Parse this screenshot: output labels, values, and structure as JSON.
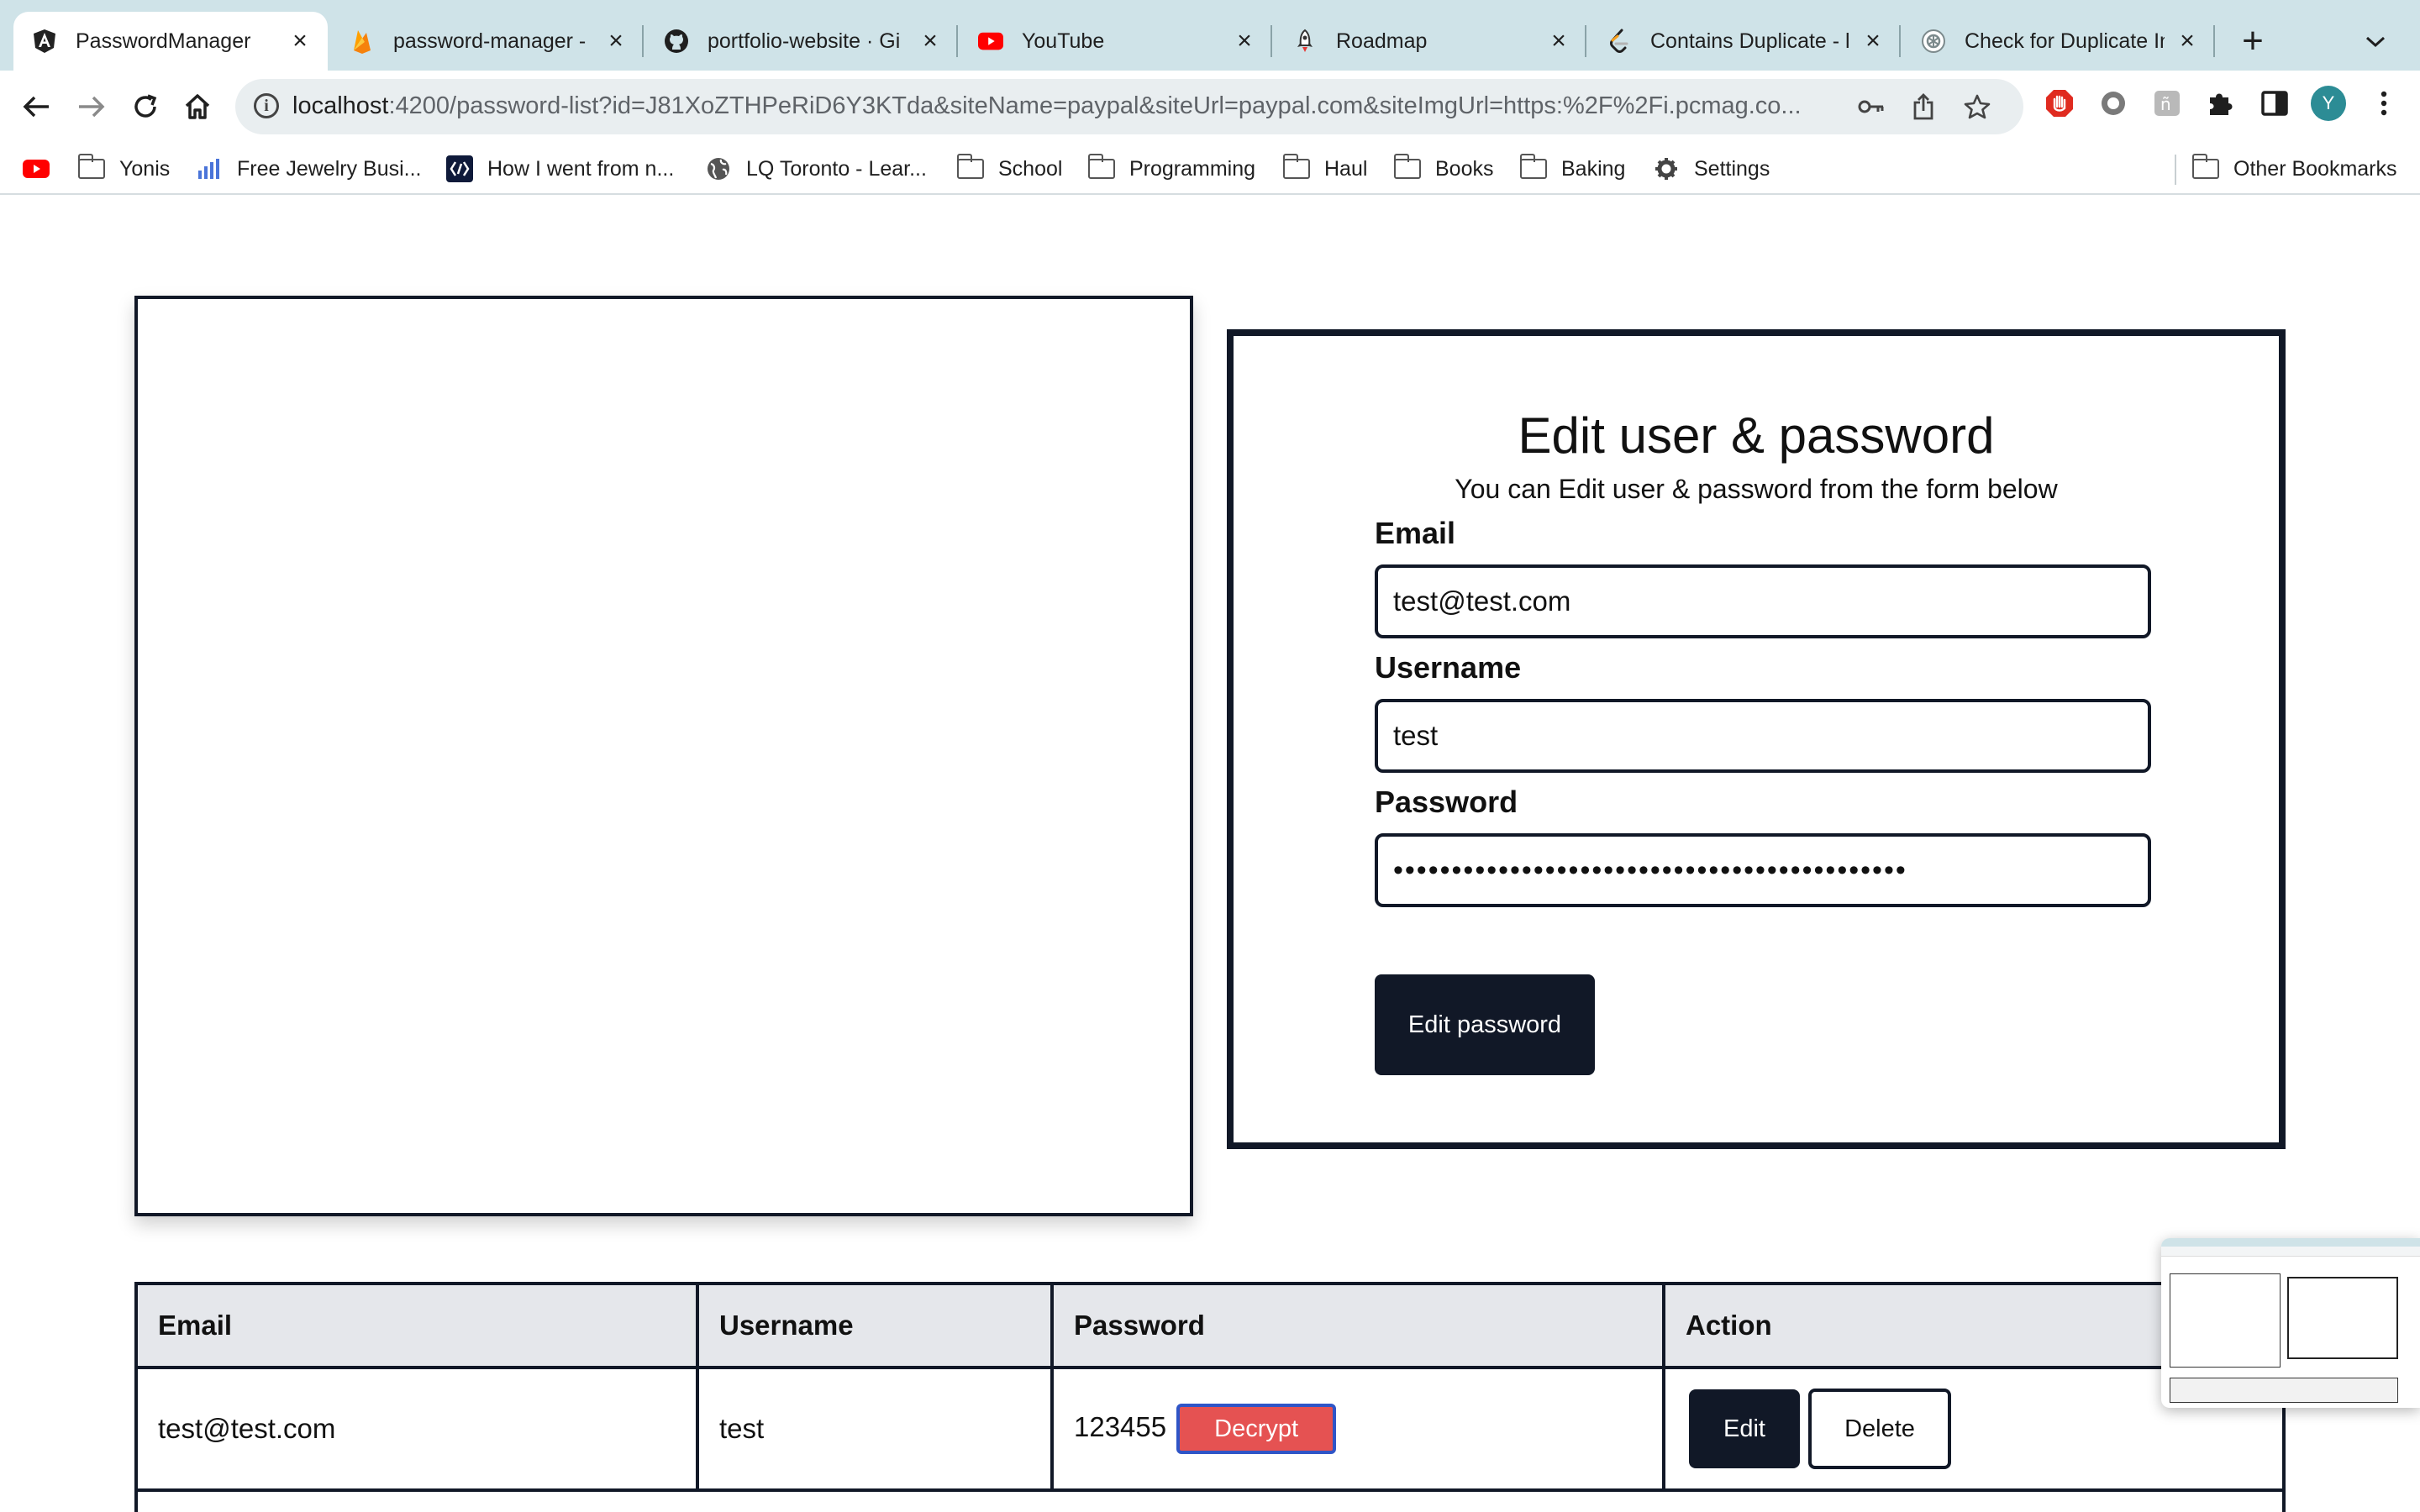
{
  "browser": {
    "tabs": [
      {
        "title": "PasswordManager",
        "icon": "angular-icon",
        "active": true
      },
      {
        "title": "password-manager - ",
        "icon": "firebase-icon",
        "active": false
      },
      {
        "title": "portfolio-website · Gi",
        "icon": "github-icon",
        "active": false
      },
      {
        "title": "YouTube",
        "icon": "youtube-icon",
        "active": false
      },
      {
        "title": "Roadmap",
        "icon": "rocket-icon",
        "active": false
      },
      {
        "title": "Contains Duplicate - l",
        "icon": "leetcode-icon",
        "active": false
      },
      {
        "title": "Check for Duplicate In",
        "icon": "openai-icon",
        "active": false
      }
    ],
    "new_tab": "+",
    "url_host": "localhost",
    "url_rest": ":4200/password-list?id=J81XoZTHPeRiD6Y3KTda&siteName=paypal&siteUrl=paypal.com&siteImgUrl=https:%2F%2Fi.pcmag.co...",
    "profile_initial": "Y",
    "bookmarks": [
      {
        "label": "",
        "icon": "youtube-icon"
      },
      {
        "label": "Yonis",
        "icon": "folder-icon"
      },
      {
        "label": "Free Jewelry Busi...",
        "icon": "chart-icon"
      },
      {
        "label": "How I went from n...",
        "icon": "site-icon"
      },
      {
        "label": "LQ Toronto - Lear...",
        "icon": "globe-icon"
      },
      {
        "label": "School",
        "icon": "folder-icon"
      },
      {
        "label": "Programming",
        "icon": "folder-icon"
      },
      {
        "label": "Haul",
        "icon": "folder-icon"
      },
      {
        "label": "Books",
        "icon": "folder-icon"
      },
      {
        "label": "Baking",
        "icon": "folder-icon"
      },
      {
        "label": "Settings",
        "icon": "gear-icon"
      }
    ],
    "other_bookmarks": "Other Bookmarks"
  },
  "form": {
    "title": "Edit user & password",
    "subtitle": "You can Edit user & password from the form below",
    "email_label": "Email",
    "email_value": "test@test.com",
    "username_label": "Username",
    "username_value": "test",
    "password_label": "Password",
    "password_value": "••••••••••••••••••••••••••••••••••••••••••••",
    "submit_label": "Edit password"
  },
  "table": {
    "headers": [
      "Email",
      "Username",
      "Password",
      "Action"
    ],
    "rows": [
      {
        "email": "test@test.com",
        "username": "test",
        "password": "123455",
        "decrypt_label": "Decrypt",
        "edit_label": "Edit",
        "delete_label": "Delete"
      }
    ]
  },
  "colors": {
    "primary": "#111827",
    "decrypt": "#e55252",
    "header_bg": "#e5e7eb",
    "tab_bar": "#cfe3e8"
  }
}
